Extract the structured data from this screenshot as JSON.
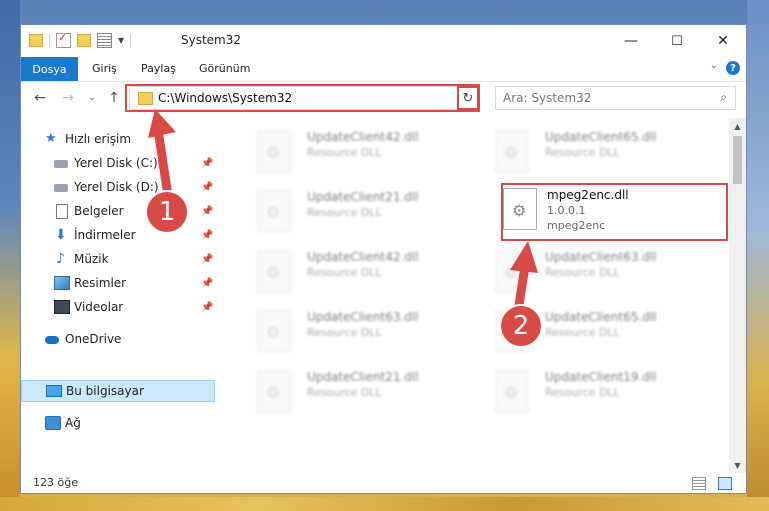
{
  "window": {
    "title": "System32",
    "controls": {
      "minimize": "—",
      "maximize": "☐",
      "close": "✕"
    }
  },
  "ribbon": {
    "tabs": [
      "Dosya",
      "Giriş",
      "Paylaş",
      "Görünüm"
    ],
    "help": "?"
  },
  "nav": {
    "address": "C:\\Windows\\System32",
    "search_placeholder": "Ara: System32"
  },
  "sidebar": {
    "items": [
      {
        "label": "Hızlı erişim",
        "icon": "star-icon"
      },
      {
        "label": "Yerel Disk (C:)",
        "icon": "disk-icon"
      },
      {
        "label": "Yerel Disk (D:)",
        "icon": "disk-icon"
      },
      {
        "label": "Belgeler",
        "icon": "documents-icon"
      },
      {
        "label": "İndirmeler",
        "icon": "downloads-icon"
      },
      {
        "label": "Müzik",
        "icon": "music-icon"
      },
      {
        "label": "Resimler",
        "icon": "pictures-icon"
      },
      {
        "label": "Videolar",
        "icon": "videos-icon"
      },
      {
        "label": "OneDrive",
        "icon": "onedrive-icon"
      },
      {
        "label": "Bu bilgisayar",
        "icon": "this-pc-icon"
      },
      {
        "label": "Ağ",
        "icon": "network-icon"
      }
    ]
  },
  "files": [
    {
      "name": "UpdateClient42.dll",
      "desc": "Resource DLL"
    },
    {
      "name": "UpdateClient65.dll",
      "desc": "Resource DLL"
    },
    {
      "name": "UpdateClient21.dll",
      "desc": "Resource DLL"
    },
    {
      "name": "mpeg2enc.dll",
      "desc": "1.0.0.1",
      "extra": "mpeg2enc"
    },
    {
      "name": "UpdateClient42.dll",
      "desc": "Resource DLL"
    },
    {
      "name": "UpdateClient63.dll",
      "desc": "Resource DLL"
    },
    {
      "name": "UpdateClient63.dll",
      "desc": "Resource DLL"
    },
    {
      "name": "UpdateClient65.dll",
      "desc": "Resource DLL"
    },
    {
      "name": "UpdateClient21.dll",
      "desc": "Resource DLL"
    },
    {
      "name": "UpdateClient19.dll",
      "desc": "Resource DLL"
    }
  ],
  "status": {
    "count": "123 öğe"
  },
  "annotations": {
    "step1": "1",
    "step2": "2",
    "accent": "#d94a47"
  }
}
